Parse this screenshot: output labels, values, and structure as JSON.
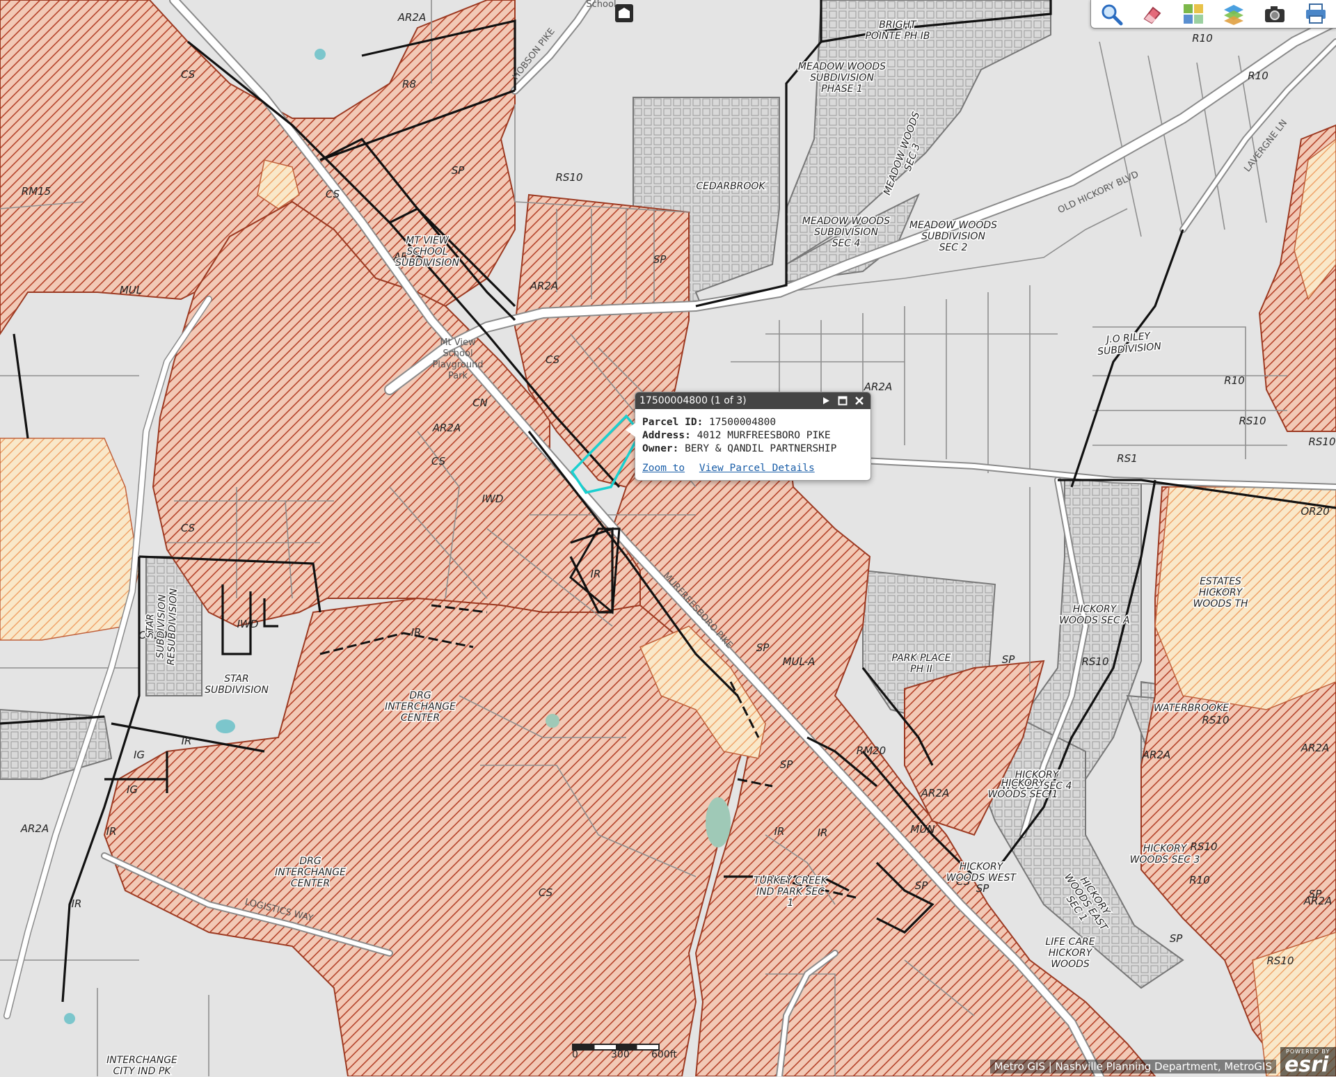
{
  "toolbar": {
    "tools": [
      {
        "name": "search-icon",
        "label": "Search"
      },
      {
        "name": "eraser-icon",
        "label": "Clear"
      },
      {
        "name": "basemap-icon",
        "label": "Basemap"
      },
      {
        "name": "layers-icon",
        "label": "Layers"
      },
      {
        "name": "camera-icon",
        "label": "Snapshot"
      },
      {
        "name": "print-icon",
        "label": "Print"
      }
    ]
  },
  "popup": {
    "title": "17500004800 (1 of 3)",
    "parcel_id_label": "Parcel ID:",
    "parcel_id": "17500004800",
    "address_label": "Address:",
    "address": "4012 MURFREESBORO PIKE",
    "owner_label": "Owner:",
    "owner": "BERY & QANDIL PARTNERSHIP",
    "zoom_link": "Zoom to",
    "details_link": "View Parcel Details"
  },
  "zoning_labels": [
    "AR2A",
    "R8",
    "CS",
    "RM15",
    "SP",
    "RS10",
    "MUL",
    "AR2A",
    "CS",
    "CS",
    "SP",
    "AR2A",
    "CN",
    "CS",
    "IWD",
    "AR2A",
    "CS",
    "IR",
    "CS",
    "IWD",
    "OR20",
    "IR",
    "IR",
    "IG",
    "IG",
    "AR2A",
    "IR",
    "IR",
    "SP",
    "MUL-A",
    "SP",
    "RM20",
    "AR2A",
    "MUN",
    "IR",
    "CS",
    "SP",
    "SP",
    "R10",
    "R10",
    "R10",
    "RS10",
    "RS1",
    "AR2A",
    "SP",
    "RS10",
    "RS10",
    "AR2A",
    "R10",
    "R20",
    "AR2A",
    "SP",
    "RS10",
    "OR20",
    "AR2A",
    "SP",
    "RS10",
    "RS10",
    "IR"
  ],
  "subdivision_labels": [
    "BRIGHT POINTE PH IB",
    "MEADOW WOODS SUBDIVISION PHASE 1",
    "MEADOW WOODS SUBDIVISION SEC 4",
    "MEADOW WOODS SUBDIVISION SEC 2",
    "MEADOW WOODS SEC 3",
    "MT VIEW SCHOOL SUBDIVISION",
    "J.O RILEY SUBDIVISION",
    "DRG INTERCHANGE CENTER",
    "DRG INTERCHANGE CENTER",
    "STAR SUBDIVISION",
    "HICKORY WOODS SEC A",
    "HICKORY WOODS SEC 4",
    "HICKORY WOODS SEC 3",
    "HICKORY WOODS SEC 1",
    "HICKORY WOODS WEST",
    "HICKORY WOODS EAST SEC 1",
    "WATERBROOKE",
    "PARK PLACE PH II",
    "LIFE CARE HICKORY WOODS",
    "INTERCHANGE CITY IND PK",
    "ESTATES HICKORY WOODS TH",
    "CEDARBROOK",
    "STAR SUBDIVISION RESUBDIVISION",
    "TURKEY CREEK IND PARK SEC 1"
  ],
  "road_labels": [
    "HOBSON PIKE",
    "OLD HICKORY BLVD",
    "LAVERGNE LN",
    "MURFREESBORO PIKE",
    "LOGISTICS WAY"
  ],
  "poi_labels": [
    "School",
    "Mt View School Playground Park"
  ],
  "scale": {
    "labels": [
      "0",
      "300",
      "600ft"
    ]
  },
  "attribution": "Metro GIS | Nashville Planning Department, MetroGIS",
  "esri": {
    "powered": "POWERED BY",
    "logo": "esri"
  },
  "colors": {
    "hatch": "#b5432a",
    "hatch_bg": "#f2c9b6",
    "sp_hatch": "#f0a46a",
    "sp_bg": "#f9e8c9",
    "map_bg": "#e4e4e4",
    "road": "#ffffff",
    "popup_header": "#444444",
    "highlight": "#1ad0d0"
  }
}
